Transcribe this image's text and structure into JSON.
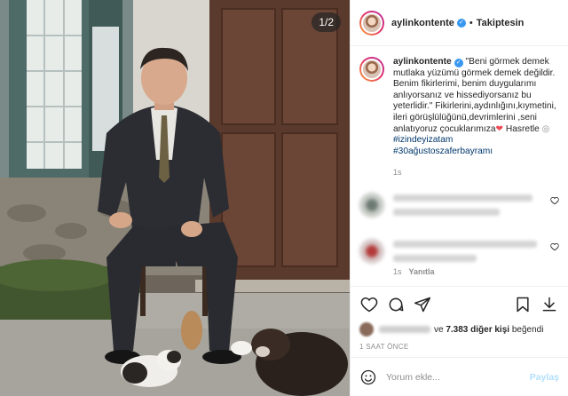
{
  "photo": {
    "counter": "1/2",
    "description_icon": "photo-image"
  },
  "header": {
    "username": "aylinkontente",
    "follow_status": "Takiptesin"
  },
  "caption": {
    "username": "aylinkontente",
    "quote": "\"Beni görmek demek mutlaka yüzümü görmek demek değildir. Benim fikirlerimi, benim duygularımı anlıyorsanız ve hissediyorsanız bu yeterlidir.\"",
    "body": "Fikirlerini,aydınlığını,kıymetini, ileri görüşlülüğünü,devrimlerini ,seni anlatıyoruz çocuklarımıza",
    "after_heart": " Hasretle",
    "hashtag1": "#izindeyizatam",
    "hashtag2": "#30ağustoszaferbayramı",
    "age": "1s"
  },
  "comments": [
    {
      "age": "",
      "reply": ""
    },
    {
      "age": "1s",
      "reply": "Yanıtla"
    }
  ],
  "likes": {
    "and_text": "ve",
    "others": "7.383 diğer kişi",
    "liked": "beğendi"
  },
  "post_time": "1 SAAT ÖNCE",
  "comment_box": {
    "placeholder": "Yorum ekle...",
    "share_label": "Paylaş"
  },
  "colors": {
    "link": "#00376b",
    "verified": "#3897f0",
    "heart": "#ed4956",
    "share_disabled": "#b2dffc"
  }
}
